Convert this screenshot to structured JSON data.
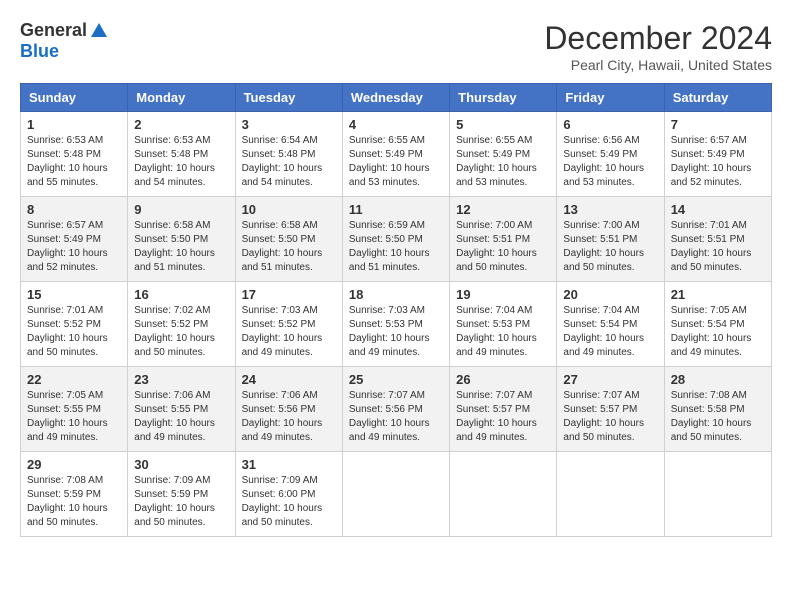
{
  "logo": {
    "general": "General",
    "blue": "Blue"
  },
  "title": "December 2024",
  "location": "Pearl City, Hawaii, United States",
  "weekdays": [
    "Sunday",
    "Monday",
    "Tuesday",
    "Wednesday",
    "Thursday",
    "Friday",
    "Saturday"
  ],
  "weeks": [
    [
      {
        "day": "1",
        "info": "Sunrise: 6:53 AM\nSunset: 5:48 PM\nDaylight: 10 hours\nand 55 minutes."
      },
      {
        "day": "2",
        "info": "Sunrise: 6:53 AM\nSunset: 5:48 PM\nDaylight: 10 hours\nand 54 minutes."
      },
      {
        "day": "3",
        "info": "Sunrise: 6:54 AM\nSunset: 5:48 PM\nDaylight: 10 hours\nand 54 minutes."
      },
      {
        "day": "4",
        "info": "Sunrise: 6:55 AM\nSunset: 5:49 PM\nDaylight: 10 hours\nand 53 minutes."
      },
      {
        "day": "5",
        "info": "Sunrise: 6:55 AM\nSunset: 5:49 PM\nDaylight: 10 hours\nand 53 minutes."
      },
      {
        "day": "6",
        "info": "Sunrise: 6:56 AM\nSunset: 5:49 PM\nDaylight: 10 hours\nand 53 minutes."
      },
      {
        "day": "7",
        "info": "Sunrise: 6:57 AM\nSunset: 5:49 PM\nDaylight: 10 hours\nand 52 minutes."
      }
    ],
    [
      {
        "day": "8",
        "info": "Sunrise: 6:57 AM\nSunset: 5:49 PM\nDaylight: 10 hours\nand 52 minutes."
      },
      {
        "day": "9",
        "info": "Sunrise: 6:58 AM\nSunset: 5:50 PM\nDaylight: 10 hours\nand 51 minutes."
      },
      {
        "day": "10",
        "info": "Sunrise: 6:58 AM\nSunset: 5:50 PM\nDaylight: 10 hours\nand 51 minutes."
      },
      {
        "day": "11",
        "info": "Sunrise: 6:59 AM\nSunset: 5:50 PM\nDaylight: 10 hours\nand 51 minutes."
      },
      {
        "day": "12",
        "info": "Sunrise: 7:00 AM\nSunset: 5:51 PM\nDaylight: 10 hours\nand 50 minutes."
      },
      {
        "day": "13",
        "info": "Sunrise: 7:00 AM\nSunset: 5:51 PM\nDaylight: 10 hours\nand 50 minutes."
      },
      {
        "day": "14",
        "info": "Sunrise: 7:01 AM\nSunset: 5:51 PM\nDaylight: 10 hours\nand 50 minutes."
      }
    ],
    [
      {
        "day": "15",
        "info": "Sunrise: 7:01 AM\nSunset: 5:52 PM\nDaylight: 10 hours\nand 50 minutes."
      },
      {
        "day": "16",
        "info": "Sunrise: 7:02 AM\nSunset: 5:52 PM\nDaylight: 10 hours\nand 50 minutes."
      },
      {
        "day": "17",
        "info": "Sunrise: 7:03 AM\nSunset: 5:52 PM\nDaylight: 10 hours\nand 49 minutes."
      },
      {
        "day": "18",
        "info": "Sunrise: 7:03 AM\nSunset: 5:53 PM\nDaylight: 10 hours\nand 49 minutes."
      },
      {
        "day": "19",
        "info": "Sunrise: 7:04 AM\nSunset: 5:53 PM\nDaylight: 10 hours\nand 49 minutes."
      },
      {
        "day": "20",
        "info": "Sunrise: 7:04 AM\nSunset: 5:54 PM\nDaylight: 10 hours\nand 49 minutes."
      },
      {
        "day": "21",
        "info": "Sunrise: 7:05 AM\nSunset: 5:54 PM\nDaylight: 10 hours\nand 49 minutes."
      }
    ],
    [
      {
        "day": "22",
        "info": "Sunrise: 7:05 AM\nSunset: 5:55 PM\nDaylight: 10 hours\nand 49 minutes."
      },
      {
        "day": "23",
        "info": "Sunrise: 7:06 AM\nSunset: 5:55 PM\nDaylight: 10 hours\nand 49 minutes."
      },
      {
        "day": "24",
        "info": "Sunrise: 7:06 AM\nSunset: 5:56 PM\nDaylight: 10 hours\nand 49 minutes."
      },
      {
        "day": "25",
        "info": "Sunrise: 7:07 AM\nSunset: 5:56 PM\nDaylight: 10 hours\nand 49 minutes."
      },
      {
        "day": "26",
        "info": "Sunrise: 7:07 AM\nSunset: 5:57 PM\nDaylight: 10 hours\nand 49 minutes."
      },
      {
        "day": "27",
        "info": "Sunrise: 7:07 AM\nSunset: 5:57 PM\nDaylight: 10 hours\nand 50 minutes."
      },
      {
        "day": "28",
        "info": "Sunrise: 7:08 AM\nSunset: 5:58 PM\nDaylight: 10 hours\nand 50 minutes."
      }
    ],
    [
      {
        "day": "29",
        "info": "Sunrise: 7:08 AM\nSunset: 5:59 PM\nDaylight: 10 hours\nand 50 minutes."
      },
      {
        "day": "30",
        "info": "Sunrise: 7:09 AM\nSunset: 5:59 PM\nDaylight: 10 hours\nand 50 minutes."
      },
      {
        "day": "31",
        "info": "Sunrise: 7:09 AM\nSunset: 6:00 PM\nDaylight: 10 hours\nand 50 minutes."
      },
      {
        "day": "",
        "info": ""
      },
      {
        "day": "",
        "info": ""
      },
      {
        "day": "",
        "info": ""
      },
      {
        "day": "",
        "info": ""
      }
    ]
  ]
}
